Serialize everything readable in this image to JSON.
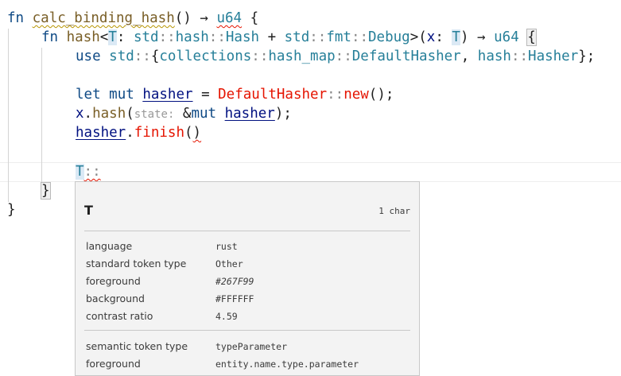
{
  "code": {
    "l1": {
      "fn": "fn",
      "name": "calc_binding_hash",
      "parens": "()",
      "arrow": "→",
      "ret": "u64",
      "brace": "{"
    },
    "l2": {
      "fn": "fn",
      "name": "hash",
      "lt": "<",
      "tp": "T",
      "colon": ": ",
      "std1": "std",
      "sep1": "::",
      "hash_mod": "hash",
      "sep2": "::",
      "hash_tr": "Hash",
      "plus": " + ",
      "std2": "std",
      "sep3": "::",
      "fmt": "fmt",
      "sep4": "::",
      "debug": "Debug",
      "gt": ">(",
      "x": "x",
      "colon2": ": ",
      "tp2": "T",
      "close": ")",
      "arrow": "→",
      "ret": "u64",
      "brace": "{"
    },
    "l3": {
      "use": "use",
      "std": "std",
      "sep": "::",
      "ob": "{",
      "coll": "collections",
      "sep2": "::",
      "hm": "hash_map",
      "sep3": "::",
      "dh": "DefaultHasher",
      "comma": ", ",
      "hash": "hash",
      "sep4": "::",
      "hasher": "Hasher",
      "cb": "};"
    },
    "l4": {
      "let": "let",
      "mut": "mut",
      "var": "hasher",
      "eq": " = ",
      "dh": "DefaultHasher",
      "sep": "::",
      "new": "new",
      "end": "();"
    },
    "l5": {
      "x": "x",
      "dot": ".",
      "hash": "hash",
      "op": "(",
      "hint": "state:",
      "amp": " &",
      "mut": "mut",
      "var": "hasher",
      "end": ");"
    },
    "l6": {
      "var": "hasher",
      "dot": ".",
      "finish": "finish",
      "op": "(",
      "cp": ")"
    },
    "l7": {
      "tp": "T",
      "sep": "::"
    },
    "l8": {
      "brace": "}"
    },
    "l9": {
      "brace": "}"
    }
  },
  "hover": {
    "title": "T",
    "length": "1 char",
    "rows1": [
      {
        "key": "language",
        "value": "rust"
      },
      {
        "key": "standard token type",
        "value": "Other"
      },
      {
        "key": "foreground",
        "value": "#267F99"
      },
      {
        "key": "background",
        "value": "#FFFFFF"
      },
      {
        "key": "contrast ratio",
        "value": "4.59"
      }
    ],
    "rows2": [
      {
        "key": "semantic token type",
        "value": "typeParameter"
      },
      {
        "key": "foreground",
        "value": "entity.name.type.parameter"
      }
    ]
  },
  "colors": {
    "keyword": "#0F4A85",
    "function": "#795E26",
    "type": "#267F99",
    "variable": "#001080",
    "struct_error": "#E51400"
  }
}
